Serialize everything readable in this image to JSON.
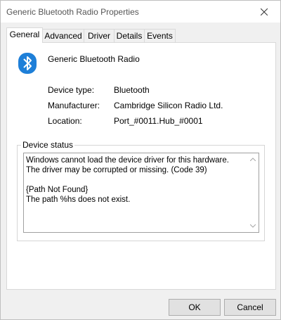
{
  "window": {
    "title": "Generic Bluetooth Radio Properties"
  },
  "tabs": [
    {
      "label": "General",
      "active": true
    },
    {
      "label": "Advanced",
      "active": false
    },
    {
      "label": "Driver",
      "active": false
    },
    {
      "label": "Details",
      "active": false
    },
    {
      "label": "Events",
      "active": false
    }
  ],
  "device": {
    "name": "Generic Bluetooth Radio",
    "icon": "bluetooth-icon"
  },
  "properties": [
    {
      "label": "Device type:",
      "value": "Bluetooth"
    },
    {
      "label": "Manufacturer:",
      "value": "Cambridge Silicon Radio Ltd."
    },
    {
      "label": "Location:",
      "value": "Port_#0011.Hub_#0001"
    }
  ],
  "device_status": {
    "legend": "Device status",
    "text": "Windows cannot load the device driver for this hardware. The driver may be corrupted or missing. (Code 39)\n\n{Path Not Found}\nThe path %hs does not exist."
  },
  "buttons": {
    "ok": "OK",
    "cancel": "Cancel"
  },
  "colors": {
    "bluetooth_blue": "#1e7fd8",
    "accent_border": "#0078d7"
  }
}
